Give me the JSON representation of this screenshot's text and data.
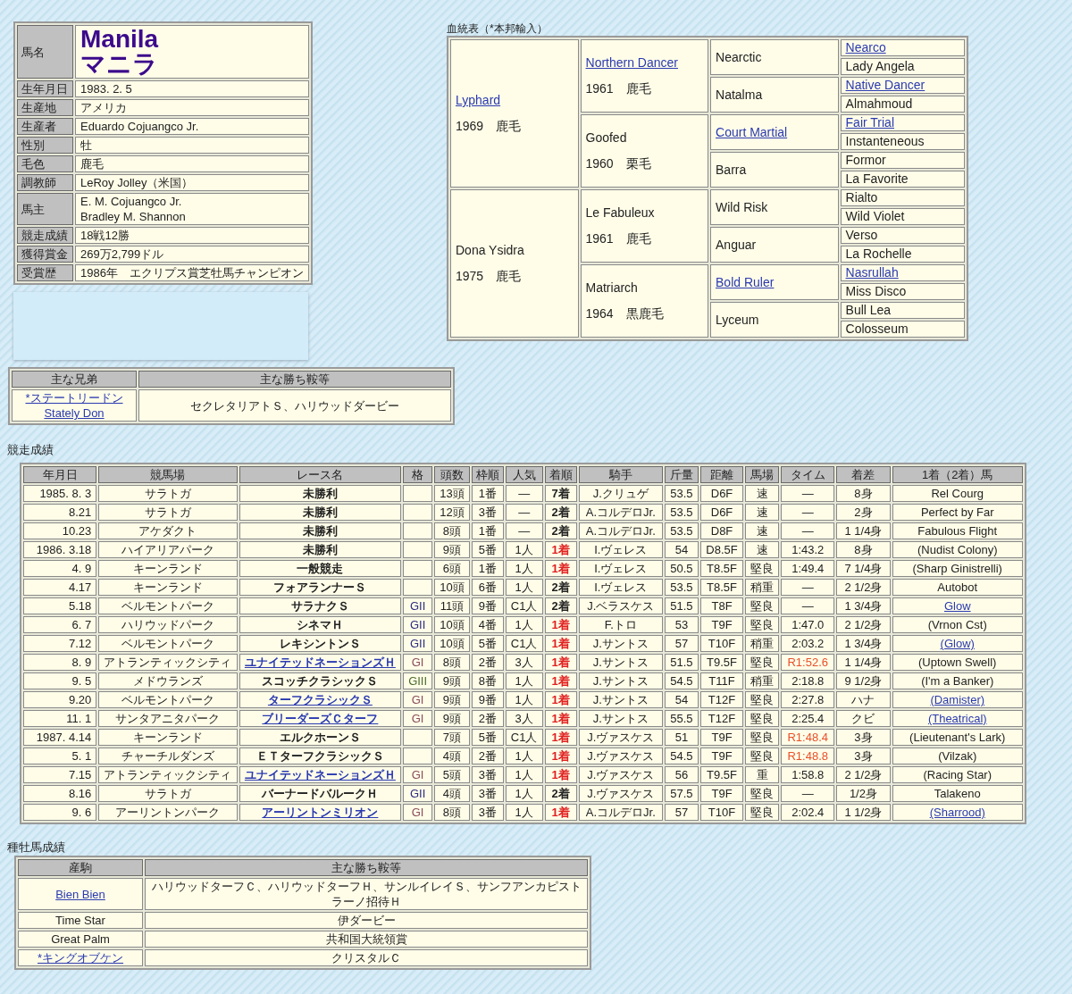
{
  "profile": {
    "name_label": "馬名",
    "name_en": "Manila",
    "name_ja": "マニラ",
    "rows": [
      {
        "label": "生年月日",
        "lines": [
          "1983. 2. 5"
        ]
      },
      {
        "label": "生産地",
        "lines": [
          "アメリカ"
        ]
      },
      {
        "label": "生産者",
        "lines": [
          "Eduardo Cojuangco Jr."
        ]
      },
      {
        "label": "性別",
        "lines": [
          "牡"
        ]
      },
      {
        "label": "毛色",
        "lines": [
          "鹿毛"
        ]
      },
      {
        "label": "調教師",
        "lines": [
          "LeRoy Jolley（米国）"
        ]
      },
      {
        "label": "馬主",
        "lines": [
          "E. M. Cojuangco Jr.",
          "Bradley M. Shannon"
        ]
      },
      {
        "label": "競走成績",
        "lines": [
          "18戦12勝"
        ]
      },
      {
        "label": "獲得賞金",
        "lines": [
          "269万2,799ドル"
        ]
      },
      {
        "label": "受賞歴",
        "lines": [
          "1986年　エクリプス賞芝牡馬チャンピオン"
        ]
      }
    ]
  },
  "pedigree": {
    "title": "血統表（*本邦輸入）",
    "gen1": [
      {
        "name": "Lyphard",
        "link": true,
        "info": "1969　鹿毛"
      },
      {
        "name": "Dona Ysidra",
        "link": false,
        "info": "1975　鹿毛"
      }
    ],
    "gen2": [
      {
        "name": "Northern Dancer",
        "link": true,
        "info": "1961　鹿毛"
      },
      {
        "name": "Goofed",
        "link": false,
        "info": "1960　栗毛"
      },
      {
        "name": "Le Fabuleux",
        "link": false,
        "info": "1961　鹿毛"
      },
      {
        "name": "Matriarch",
        "link": false,
        "info": "1964　黒鹿毛"
      }
    ],
    "gen3": [
      {
        "name": "Nearctic",
        "link": false
      },
      {
        "name": "Natalma",
        "link": false
      },
      {
        "name": "Court Martial",
        "link": true
      },
      {
        "name": "Barra",
        "link": false
      },
      {
        "name": "Wild Risk",
        "link": false
      },
      {
        "name": "Anguar",
        "link": false
      },
      {
        "name": "Bold Ruler",
        "link": true
      },
      {
        "name": "Lyceum",
        "link": false
      }
    ],
    "gen4": [
      {
        "name": "Nearco",
        "link": true
      },
      {
        "name": "Lady Angela",
        "link": false
      },
      {
        "name": "Native Dancer",
        "link": true
      },
      {
        "name": "Almahmoud",
        "link": false
      },
      {
        "name": "Fair Trial",
        "link": true
      },
      {
        "name": "Instanteneous",
        "link": false
      },
      {
        "name": "Formor",
        "link": false
      },
      {
        "name": "La Favorite",
        "link": false
      },
      {
        "name": "Rialto",
        "link": false
      },
      {
        "name": "Wild Violet",
        "link": false
      },
      {
        "name": "Verso",
        "link": false
      },
      {
        "name": "La Rochelle",
        "link": false
      },
      {
        "name": "Nasrullah",
        "link": true
      },
      {
        "name": "Miss Disco",
        "link": false
      },
      {
        "name": "Bull Lea",
        "link": false
      },
      {
        "name": "Colosseum",
        "link": false
      }
    ]
  },
  "siblings": {
    "columns": [
      "主な兄弟",
      "主な勝ち鞍等"
    ],
    "rows": [
      {
        "names": [
          "*ステートリードン",
          "Stately Don"
        ],
        "link": true,
        "wins": "セクレタリアトＳ、ハリウッドダービー"
      }
    ]
  },
  "races": {
    "title": "競走成績",
    "columns": [
      "年月日",
      "競馬場",
      "レース名",
      "格",
      "頭数",
      "枠順",
      "人気",
      "着順",
      "騎手",
      "斤量",
      "距離",
      "馬場",
      "タイム",
      "着差",
      "1着（2着）馬"
    ],
    "rows": [
      {
        "date": "1985. 8. 3",
        "track": "サラトガ",
        "race": {
          "text": "未勝利",
          "link": false
        },
        "runners": "13頭",
        "post": "1番",
        "pop": "—",
        "finish": {
          "text": "7着",
          "kind": "other"
        },
        "jockey": "J.クリュゲ",
        "weight": "53.5",
        "dist": "D6F",
        "going": "速",
        "time": {
          "text": "—",
          "record": false
        },
        "margin": "8身",
        "winner": {
          "text": "Rel Courg",
          "link": false
        }
      },
      {
        "date": "8.21",
        "track": "サラトガ",
        "race": {
          "text": "未勝利",
          "link": false
        },
        "runners": "12頭",
        "post": "3番",
        "pop": "—",
        "finish": {
          "text": "2着",
          "kind": "second"
        },
        "jockey": "A.コルデロJr.",
        "weight": "53.5",
        "dist": "D6F",
        "going": "速",
        "time": {
          "text": "—",
          "record": false
        },
        "margin": "2身",
        "winner": {
          "text": "Perfect by Far",
          "link": false
        }
      },
      {
        "date": "10.23",
        "track": "アケダクト",
        "race": {
          "text": "未勝利",
          "link": false
        },
        "runners": "8頭",
        "post": "1番",
        "pop": "—",
        "finish": {
          "text": "2着",
          "kind": "second"
        },
        "jockey": "A.コルデロJr.",
        "weight": "53.5",
        "dist": "D8F",
        "going": "速",
        "time": {
          "text": "—",
          "record": false
        },
        "margin": "1 1/4身",
        "winner": {
          "text": "Fabulous Flight",
          "link": false
        }
      },
      {
        "date": "1986. 3.18",
        "track": "ハイアリアパーク",
        "race": {
          "text": "未勝利",
          "link": false
        },
        "runners": "9頭",
        "post": "5番",
        "pop": "1人",
        "finish": {
          "text": "1着",
          "kind": "win"
        },
        "jockey": "I.ヴェレス",
        "weight": "54",
        "dist": "D8.5F",
        "going": "速",
        "time": {
          "text": "1:43.2",
          "record": false
        },
        "margin": "8身",
        "winner": {
          "text": "(Nudist Colony)",
          "link": false
        }
      },
      {
        "date": "4. 9",
        "track": "キーンランド",
        "race": {
          "text": "一般競走",
          "link": false
        },
        "runners": "6頭",
        "post": "1番",
        "pop": "1人",
        "finish": {
          "text": "1着",
          "kind": "win"
        },
        "jockey": "I.ヴェレス",
        "weight": "50.5",
        "dist": "T8.5F",
        "going": "堅良",
        "time": {
          "text": "1:49.4",
          "record": false
        },
        "margin": "7 1/4身",
        "winner": {
          "text": "(Sharp Ginistrelli)",
          "link": false
        }
      },
      {
        "date": "4.17",
        "track": "キーンランド",
        "race": {
          "text": "フォアランナーＳ",
          "link": false
        },
        "runners": "10頭",
        "post": "6番",
        "pop": "1人",
        "finish": {
          "text": "2着",
          "kind": "second"
        },
        "jockey": "I.ヴェレス",
        "weight": "53.5",
        "dist": "T8.5F",
        "going": "稍重",
        "time": {
          "text": "—",
          "record": false
        },
        "margin": "2 1/2身",
        "winner": {
          "text": "Autobot",
          "link": false
        }
      },
      {
        "date": "5.18",
        "track": "ベルモントパーク",
        "race": {
          "text": "サラナクＳ",
          "link": false
        },
        "grade": {
          "text": "GII",
          "color": "#2b2b80"
        },
        "runners": "11頭",
        "post": "9番",
        "pop": "C1人",
        "finish": {
          "text": "2着",
          "kind": "second"
        },
        "jockey": "J.ベラスケス",
        "weight": "51.5",
        "dist": "T8F",
        "going": "堅良",
        "time": {
          "text": "—",
          "record": false
        },
        "margin": "1 3/4身",
        "winner": {
          "text": "Glow",
          "link": true
        }
      },
      {
        "date": "6. 7",
        "track": "ハリウッドパーク",
        "race": {
          "text": "シネマＨ",
          "link": false
        },
        "grade": {
          "text": "GII",
          "color": "#2b2b80"
        },
        "runners": "10頭",
        "post": "4番",
        "pop": "1人",
        "finish": {
          "text": "1着",
          "kind": "win"
        },
        "jockey": "F.トロ",
        "weight": "53",
        "dist": "T9F",
        "going": "堅良",
        "time": {
          "text": "1:47.0",
          "record": false
        },
        "margin": "2 1/2身",
        "winner": {
          "text": "(Vrnon Cst)",
          "link": false
        }
      },
      {
        "date": "7.12",
        "track": "ベルモントパーク",
        "race": {
          "text": "レキシントンＳ",
          "link": false
        },
        "grade": {
          "text": "GII",
          "color": "#2b2b80"
        },
        "runners": "10頭",
        "post": "5番",
        "pop": "C1人",
        "finish": {
          "text": "1着",
          "kind": "win"
        },
        "jockey": "J.サントス",
        "weight": "57",
        "dist": "T10F",
        "going": "稍重",
        "time": {
          "text": "2:03.2",
          "record": false
        },
        "margin": "1 3/4身",
        "winner": {
          "text": "(Glow)",
          "link": true
        }
      },
      {
        "date": "8. 9",
        "track": "アトランティックシティ",
        "race": {
          "text": "ユナイテッドネーションズＨ",
          "link": true
        },
        "grade": {
          "text": "GI",
          "color": "#8a4a5a"
        },
        "runners": "8頭",
        "post": "2番",
        "pop": "3人",
        "finish": {
          "text": "1着",
          "kind": "win"
        },
        "jockey": "J.サントス",
        "weight": "51.5",
        "dist": "T9.5F",
        "going": "堅良",
        "time": {
          "text": "R1:52.6",
          "record": true
        },
        "margin": "1 1/4身",
        "winner": {
          "text": "(Uptown Swell)",
          "link": false
        }
      },
      {
        "date": "9. 5",
        "track": "メドウランズ",
        "race": {
          "text": "スコッチクラシックＳ",
          "link": false
        },
        "grade": {
          "text": "GIII",
          "color": "#4a6a2a"
        },
        "runners": "9頭",
        "post": "8番",
        "pop": "1人",
        "finish": {
          "text": "1着",
          "kind": "win"
        },
        "jockey": "J.サントス",
        "weight": "54.5",
        "dist": "T11F",
        "going": "稍重",
        "time": {
          "text": "2:18.8",
          "record": false
        },
        "margin": "9 1/2身",
        "winner": {
          "text": "(I'm a Banker)",
          "link": false
        }
      },
      {
        "date": "9.20",
        "track": "ベルモントパーク",
        "race": {
          "text": "ターフクラシックＳ",
          "link": true
        },
        "grade": {
          "text": "GI",
          "color": "#8a4a5a"
        },
        "runners": "9頭",
        "post": "9番",
        "pop": "1人",
        "finish": {
          "text": "1着",
          "kind": "win"
        },
        "jockey": "J.サントス",
        "weight": "54",
        "dist": "T12F",
        "going": "堅良",
        "time": {
          "text": "2:27.8",
          "record": false
        },
        "margin": "ハナ",
        "winner": {
          "text": "(Damister)",
          "link": true
        }
      },
      {
        "date": "11. 1",
        "track": "サンタアニタパーク",
        "race": {
          "text": "ブリーダーズＣターフ",
          "link": true
        },
        "grade": {
          "text": "GI",
          "color": "#8a4a5a"
        },
        "runners": "9頭",
        "post": "2番",
        "pop": "3人",
        "finish": {
          "text": "1着",
          "kind": "win"
        },
        "jockey": "J.サントス",
        "weight": "55.5",
        "dist": "T12F",
        "going": "堅良",
        "time": {
          "text": "2:25.4",
          "record": false
        },
        "margin": "クビ",
        "winner": {
          "text": "(Theatrical)",
          "link": true
        }
      },
      {
        "date": "1987. 4.14",
        "track": "キーンランド",
        "race": {
          "text": "エルクホーンＳ",
          "link": false
        },
        "runners": "7頭",
        "post": "5番",
        "pop": "C1人",
        "finish": {
          "text": "1着",
          "kind": "win"
        },
        "jockey": "J.ヴァスケス",
        "weight": "51",
        "dist": "T9F",
        "going": "堅良",
        "time": {
          "text": "R1:48.4",
          "record": true
        },
        "margin": "3身",
        "winner": {
          "text": "(Lieutenant's Lark)",
          "link": false
        }
      },
      {
        "date": "5. 1",
        "track": "チャーチルダンズ",
        "race": {
          "text": "ＥＴターフクラシックＳ",
          "link": false
        },
        "runners": "4頭",
        "post": "2番",
        "pop": "1人",
        "finish": {
          "text": "1着",
          "kind": "win"
        },
        "jockey": "J.ヴァスケス",
        "weight": "54.5",
        "dist": "T9F",
        "going": "堅良",
        "time": {
          "text": "R1:48.8",
          "record": true
        },
        "margin": "3身",
        "winner": {
          "text": "(Vilzak)",
          "link": false
        }
      },
      {
        "date": "7.15",
        "track": "アトランティックシティ",
        "race": {
          "text": "ユナイテッドネーションズＨ",
          "link": true
        },
        "grade": {
          "text": "GI",
          "color": "#8a4a5a"
        },
        "runners": "5頭",
        "post": "3番",
        "pop": "1人",
        "finish": {
          "text": "1着",
          "kind": "win"
        },
        "jockey": "J.ヴァスケス",
        "weight": "56",
        "dist": "T9.5F",
        "going": "重",
        "time": {
          "text": "1:58.8",
          "record": false
        },
        "margin": "2 1/2身",
        "winner": {
          "text": "(Racing Star)",
          "link": false
        }
      },
      {
        "date": "8.16",
        "track": "サラトガ",
        "race": {
          "text": "バーナードバルークＨ",
          "link": false
        },
        "grade": {
          "text": "GII",
          "color": "#2b2b80"
        },
        "runners": "4頭",
        "post": "3番",
        "pop": "1人",
        "finish": {
          "text": "2着",
          "kind": "second"
        },
        "jockey": "J.ヴァスケス",
        "weight": "57.5",
        "dist": "T9F",
        "going": "堅良",
        "time": {
          "text": "—",
          "record": false
        },
        "margin": "1/2身",
        "winner": {
          "text": "Talakeno",
          "link": false
        }
      },
      {
        "date": "9. 6",
        "track": "アーリントンパーク",
        "race": {
          "text": "アーリントンミリオン",
          "link": true
        },
        "grade": {
          "text": "GI",
          "color": "#8a4a5a"
        },
        "runners": "8頭",
        "post": "3番",
        "pop": "1人",
        "finish": {
          "text": "1着",
          "kind": "win"
        },
        "jockey": "A.コルデロJr.",
        "weight": "57",
        "dist": "T10F",
        "going": "堅良",
        "time": {
          "text": "2:02.4",
          "record": false
        },
        "margin": "1 1/2身",
        "winner": {
          "text": "(Sharrood)",
          "link": true
        }
      }
    ]
  },
  "stud": {
    "title": "種牡馬成績",
    "columns": [
      "産駒",
      "主な勝ち鞍等"
    ],
    "rows": [
      {
        "name": "Bien Bien",
        "link": true,
        "wins": "ハリウッドターフＣ、ハリウッドターフＨ、サンルイレイＳ、サンフアンカピストラーノ招待Ｈ"
      },
      {
        "name": "Time Star",
        "link": false,
        "wins": "伊ダービー"
      },
      {
        "name": "Great Palm",
        "link": false,
        "wins": "共和国大統領賞"
      },
      {
        "name": "*キングオブケン",
        "link": true,
        "wins": "クリスタルＣ"
      }
    ]
  }
}
